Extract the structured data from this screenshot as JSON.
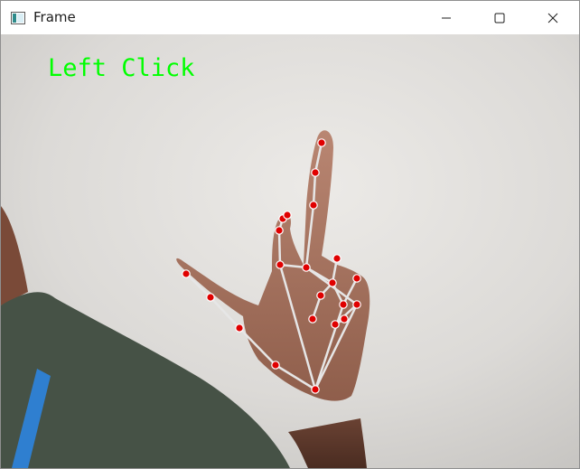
{
  "window": {
    "title": "Frame",
    "icons": {
      "app": "window-frame-icon",
      "minimize": "minimize-icon",
      "maximize": "maximize-icon",
      "close": "close-icon"
    }
  },
  "video": {
    "overlay_text": "Left Click",
    "overlay_color": "#00ff00",
    "landmark_color": "#e00000",
    "connection_color": "#e6e6e6"
  }
}
